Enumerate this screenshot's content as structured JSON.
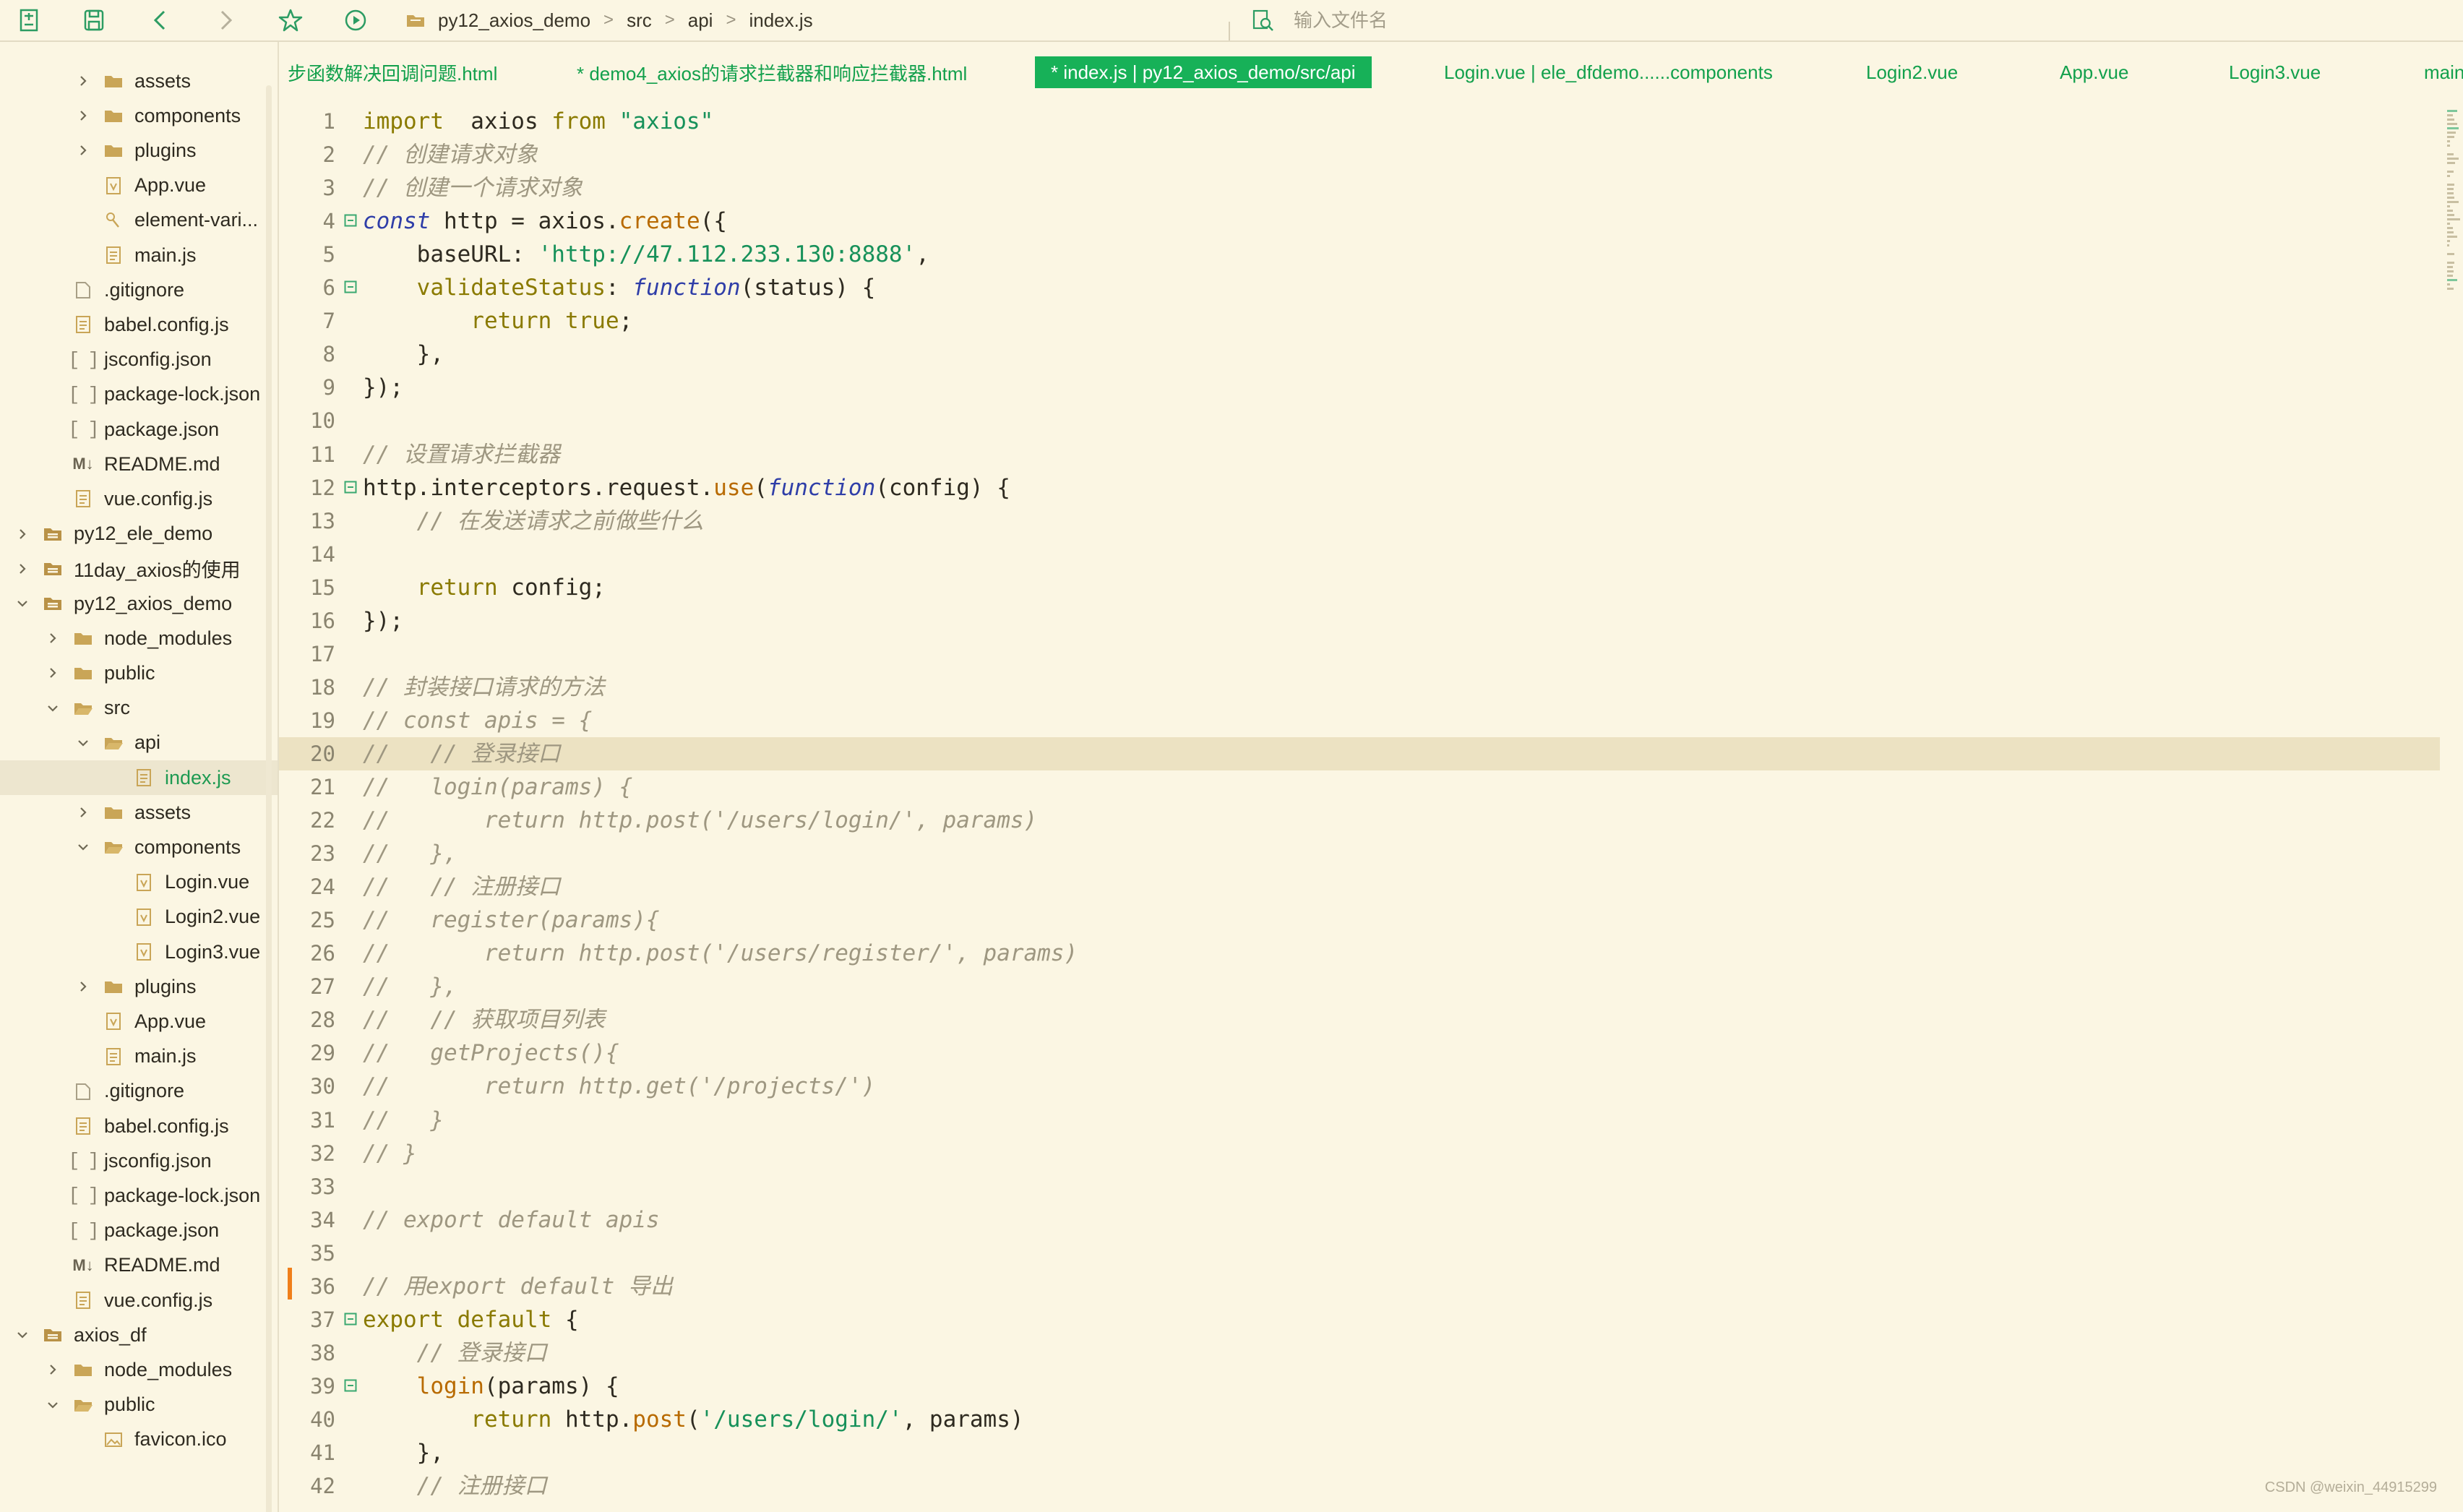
{
  "toolbar": {
    "breadcrumb": [
      "py12_axios_demo",
      "src",
      "api",
      "index.js"
    ],
    "file_search_placeholder": "输入文件名",
    "icons": [
      "new-file-icon",
      "save-icon",
      "back-icon",
      "forward-icon",
      "favorite-icon",
      "run-icon",
      "folder-icon",
      "file-search-icon"
    ]
  },
  "sidebar": {
    "items": [
      {
        "label": "assets",
        "type": "folder",
        "depth": 2,
        "expanded": false
      },
      {
        "label": "components",
        "type": "folder",
        "depth": 2,
        "expanded": false
      },
      {
        "label": "plugins",
        "type": "folder",
        "depth": 2,
        "expanded": false
      },
      {
        "label": "App.vue",
        "type": "vue",
        "depth": 2
      },
      {
        "label": "element-vari...",
        "type": "link",
        "depth": 2
      },
      {
        "label": "main.js",
        "type": "js",
        "depth": 2
      },
      {
        "label": ".gitignore",
        "type": "file",
        "depth": 1
      },
      {
        "label": "babel.config.js",
        "type": "js",
        "depth": 1
      },
      {
        "label": "jsconfig.json",
        "type": "json",
        "depth": 1
      },
      {
        "label": "package-lock.json",
        "type": "json",
        "depth": 1
      },
      {
        "label": "package.json",
        "type": "json",
        "depth": 1
      },
      {
        "label": "README.md",
        "type": "md",
        "depth": 1
      },
      {
        "label": "vue.config.js",
        "type": "js",
        "depth": 1
      },
      {
        "label": "py12_ele_demo",
        "type": "project",
        "depth": 0,
        "expanded": false
      },
      {
        "label": "11day_axios的使用",
        "type": "project",
        "depth": 0,
        "expanded": false
      },
      {
        "label": "py12_axios_demo",
        "type": "project",
        "depth": 0,
        "expanded": true
      },
      {
        "label": "node_modules",
        "type": "folder",
        "depth": 1,
        "expanded": false
      },
      {
        "label": "public",
        "type": "folder",
        "depth": 1,
        "expanded": false
      },
      {
        "label": "src",
        "type": "folder-open",
        "depth": 1,
        "expanded": true
      },
      {
        "label": "api",
        "type": "folder-open",
        "depth": 2,
        "expanded": true
      },
      {
        "label": "index.js",
        "type": "js",
        "depth": 3,
        "selected": true
      },
      {
        "label": "assets",
        "type": "folder",
        "depth": 2,
        "expanded": false
      },
      {
        "label": "components",
        "type": "folder-open",
        "depth": 2,
        "expanded": true
      },
      {
        "label": "Login.vue",
        "type": "vue",
        "depth": 3
      },
      {
        "label": "Login2.vue",
        "type": "vue",
        "depth": 3
      },
      {
        "label": "Login3.vue",
        "type": "vue",
        "depth": 3
      },
      {
        "label": "plugins",
        "type": "folder",
        "depth": 2,
        "expanded": false
      },
      {
        "label": "App.vue",
        "type": "vue",
        "depth": 2
      },
      {
        "label": "main.js",
        "type": "js",
        "depth": 2
      },
      {
        "label": ".gitignore",
        "type": "file",
        "depth": 1
      },
      {
        "label": "babel.config.js",
        "type": "js",
        "depth": 1
      },
      {
        "label": "jsconfig.json",
        "type": "json",
        "depth": 1
      },
      {
        "label": "package-lock.json",
        "type": "json",
        "depth": 1
      },
      {
        "label": "package.json",
        "type": "json",
        "depth": 1
      },
      {
        "label": "README.md",
        "type": "md",
        "depth": 1
      },
      {
        "label": "vue.config.js",
        "type": "js",
        "depth": 1
      },
      {
        "label": "axios_df",
        "type": "project",
        "depth": 0,
        "expanded": true
      },
      {
        "label": "node_modules",
        "type": "folder",
        "depth": 1,
        "expanded": false
      },
      {
        "label": "public",
        "type": "folder-open",
        "depth": 1,
        "expanded": true
      },
      {
        "label": "favicon.ico",
        "type": "image",
        "depth": 2
      }
    ]
  },
  "tabs": [
    {
      "label": "步函数解决回调问题.html",
      "active": false
    },
    {
      "label": "* demo4_axios的请求拦截器和响应拦截器.html",
      "active": false
    },
    {
      "label": "* index.js | py12_axios_demo/src/api",
      "active": true
    },
    {
      "label": "Login.vue | ele_dfdemo......components",
      "active": false
    },
    {
      "label": "Login2.vue",
      "active": false
    },
    {
      "label": "App.vue",
      "active": false
    },
    {
      "label": "Login3.vue",
      "active": false
    },
    {
      "label": "main",
      "active": false
    }
  ],
  "editor": {
    "highlighted_line": 20,
    "modified_line": 36,
    "lines": [
      {
        "n": "1",
        "fold": false,
        "t": [
          [
            "k",
            "import"
          ],
          [
            "",
            "  axios "
          ],
          [
            "k",
            "from"
          ],
          [
            "",
            ""
          ],
          [
            "s",
            " \"axios\""
          ]
        ]
      },
      {
        "n": "2",
        "fold": false,
        "t": [
          [
            "c",
            "// 创建请求对象"
          ]
        ]
      },
      {
        "n": "3",
        "fold": false,
        "t": [
          [
            "c",
            "// 创建一个请求对象"
          ]
        ]
      },
      {
        "n": "4",
        "fold": true,
        "t": [
          [
            "kb",
            "const"
          ],
          [
            "",
            " http = axios."
          ],
          [
            "f",
            "create"
          ],
          [
            "",
            "({"
          ]
        ]
      },
      {
        "n": "5",
        "fold": false,
        "t": [
          [
            "",
            "    baseURL: "
          ],
          [
            "s",
            "'http://47.112.233.130:8888'"
          ],
          [
            "",
            ","
          ]
        ]
      },
      {
        "n": "6",
        "fold": true,
        "t": [
          [
            "p",
            "    validateStatus"
          ],
          [
            "",
            ": "
          ],
          [
            "kb",
            "function"
          ],
          [
            "",
            "(status) {"
          ]
        ]
      },
      {
        "n": "7",
        "fold": false,
        "t": [
          [
            "k",
            "        return true"
          ],
          [
            "",
            ";"
          ]
        ]
      },
      {
        "n": "8",
        "fold": false,
        "t": [
          [
            "",
            "    },"
          ]
        ]
      },
      {
        "n": "9",
        "fold": false,
        "t": [
          [
            "",
            "});"
          ]
        ]
      },
      {
        "n": "10",
        "fold": false,
        "t": []
      },
      {
        "n": "11",
        "fold": false,
        "t": [
          [
            "c",
            "// 设置请求拦截器"
          ]
        ]
      },
      {
        "n": "12",
        "fold": true,
        "t": [
          [
            "",
            "http.interceptors.request."
          ],
          [
            "f",
            "use"
          ],
          [
            "",
            "("
          ],
          [
            "kb",
            "function"
          ],
          [
            "",
            "(config) {"
          ]
        ]
      },
      {
        "n": "13",
        "fold": false,
        "t": [
          [
            "c",
            "    // 在发送请求之前做些什么"
          ]
        ]
      },
      {
        "n": "14",
        "fold": false,
        "t": []
      },
      {
        "n": "15",
        "fold": false,
        "t": [
          [
            "k",
            "    return"
          ],
          [
            "",
            " config;"
          ]
        ]
      },
      {
        "n": "16",
        "fold": false,
        "t": [
          [
            "",
            "});"
          ]
        ]
      },
      {
        "n": "17",
        "fold": false,
        "t": []
      },
      {
        "n": "18",
        "fold": false,
        "t": [
          [
            "c",
            "// 封装接口请求的方法"
          ]
        ]
      },
      {
        "n": "19",
        "fold": false,
        "t": [
          [
            "c",
            "// const apis = {"
          ]
        ]
      },
      {
        "n": "20",
        "fold": false,
        "t": [
          [
            "c",
            "//   // 登录接口"
          ]
        ]
      },
      {
        "n": "21",
        "fold": false,
        "t": [
          [
            "c",
            "//   login(params) {"
          ]
        ]
      },
      {
        "n": "22",
        "fold": false,
        "t": [
          [
            "c",
            "//       return http.post('/users/login/', params)"
          ]
        ]
      },
      {
        "n": "23",
        "fold": false,
        "t": [
          [
            "c",
            "//   },"
          ]
        ]
      },
      {
        "n": "24",
        "fold": false,
        "t": [
          [
            "c",
            "//   // 注册接口"
          ]
        ]
      },
      {
        "n": "25",
        "fold": false,
        "t": [
          [
            "c",
            "//   register(params){"
          ]
        ]
      },
      {
        "n": "26",
        "fold": false,
        "t": [
          [
            "c",
            "//       return http.post('/users/register/', params)"
          ]
        ]
      },
      {
        "n": "27",
        "fold": false,
        "t": [
          [
            "c",
            "//   },"
          ]
        ]
      },
      {
        "n": "28",
        "fold": false,
        "t": [
          [
            "c",
            "//   // 获取项目列表"
          ]
        ]
      },
      {
        "n": "29",
        "fold": false,
        "t": [
          [
            "c",
            "//   getProjects(){"
          ]
        ]
      },
      {
        "n": "30",
        "fold": false,
        "t": [
          [
            "c",
            "//       return http.get('/projects/')"
          ]
        ]
      },
      {
        "n": "31",
        "fold": false,
        "t": [
          [
            "c",
            "//   }"
          ]
        ]
      },
      {
        "n": "32",
        "fold": false,
        "t": [
          [
            "c",
            "// }"
          ]
        ]
      },
      {
        "n": "33",
        "fold": false,
        "t": []
      },
      {
        "n": "34",
        "fold": false,
        "t": [
          [
            "c",
            "// export default apis"
          ]
        ]
      },
      {
        "n": "35",
        "fold": false,
        "t": []
      },
      {
        "n": "36",
        "fold": false,
        "t": [
          [
            "c",
            "// 用export default 导出"
          ]
        ]
      },
      {
        "n": "37",
        "fold": true,
        "t": [
          [
            "k",
            "export default"
          ],
          [
            "",
            " {"
          ]
        ]
      },
      {
        "n": "38",
        "fold": false,
        "t": [
          [
            "c",
            "    // 登录接口"
          ]
        ]
      },
      {
        "n": "39",
        "fold": true,
        "t": [
          [
            "f",
            "    login"
          ],
          [
            "",
            "(params) {"
          ]
        ]
      },
      {
        "n": "40",
        "fold": false,
        "t": [
          [
            "k",
            "        return"
          ],
          [
            "",
            " http."
          ],
          [
            "f",
            "post"
          ],
          [
            "",
            "("
          ],
          [
            "s",
            "'/users/login/'"
          ],
          [
            "",
            ", params)"
          ]
        ]
      },
      {
        "n": "41",
        "fold": false,
        "t": [
          [
            "",
            "    },"
          ]
        ]
      },
      {
        "n": "42",
        "fold": false,
        "t": [
          [
            "c",
            "    // 注册接口"
          ]
        ]
      }
    ]
  },
  "watermark": "CSDN @weixin_44915299",
  "colors": {
    "active_tab": "#17b158",
    "tab_text": "#12a04c",
    "background": "#fbf6e3",
    "highlight_line": "#ece2c2",
    "modified_marker": "#f07f1a"
  }
}
